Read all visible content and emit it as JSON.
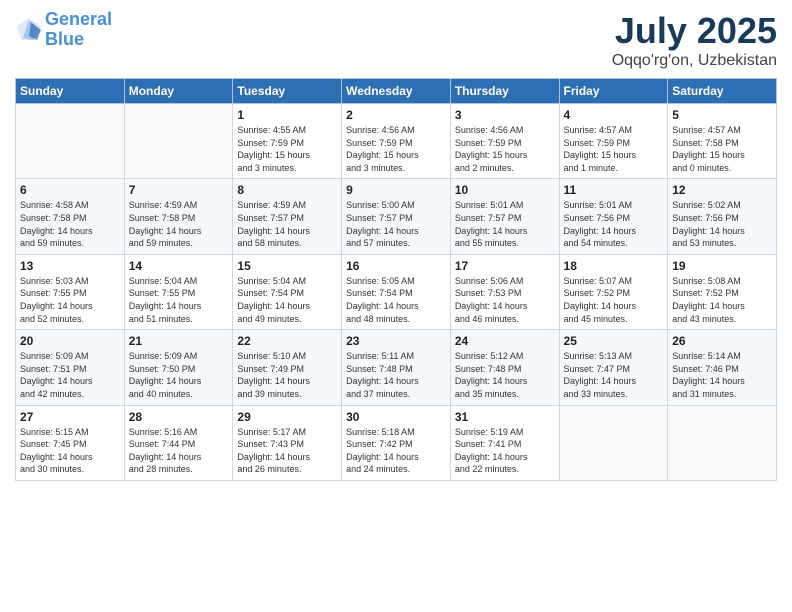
{
  "header": {
    "logo_line1": "General",
    "logo_line2": "Blue",
    "title": "July 2025",
    "subtitle": "Oqqo'rg'on, Uzbekistan"
  },
  "weekdays": [
    "Sunday",
    "Monday",
    "Tuesday",
    "Wednesday",
    "Thursday",
    "Friday",
    "Saturday"
  ],
  "weeks": [
    [
      {
        "day": "",
        "info": ""
      },
      {
        "day": "",
        "info": ""
      },
      {
        "day": "1",
        "info": "Sunrise: 4:55 AM\nSunset: 7:59 PM\nDaylight: 15 hours\nand 3 minutes."
      },
      {
        "day": "2",
        "info": "Sunrise: 4:56 AM\nSunset: 7:59 PM\nDaylight: 15 hours\nand 3 minutes."
      },
      {
        "day": "3",
        "info": "Sunrise: 4:56 AM\nSunset: 7:59 PM\nDaylight: 15 hours\nand 2 minutes."
      },
      {
        "day": "4",
        "info": "Sunrise: 4:57 AM\nSunset: 7:59 PM\nDaylight: 15 hours\nand 1 minute."
      },
      {
        "day": "5",
        "info": "Sunrise: 4:57 AM\nSunset: 7:58 PM\nDaylight: 15 hours\nand 0 minutes."
      }
    ],
    [
      {
        "day": "6",
        "info": "Sunrise: 4:58 AM\nSunset: 7:58 PM\nDaylight: 14 hours\nand 59 minutes."
      },
      {
        "day": "7",
        "info": "Sunrise: 4:59 AM\nSunset: 7:58 PM\nDaylight: 14 hours\nand 59 minutes."
      },
      {
        "day": "8",
        "info": "Sunrise: 4:59 AM\nSunset: 7:57 PM\nDaylight: 14 hours\nand 58 minutes."
      },
      {
        "day": "9",
        "info": "Sunrise: 5:00 AM\nSunset: 7:57 PM\nDaylight: 14 hours\nand 57 minutes."
      },
      {
        "day": "10",
        "info": "Sunrise: 5:01 AM\nSunset: 7:57 PM\nDaylight: 14 hours\nand 55 minutes."
      },
      {
        "day": "11",
        "info": "Sunrise: 5:01 AM\nSunset: 7:56 PM\nDaylight: 14 hours\nand 54 minutes."
      },
      {
        "day": "12",
        "info": "Sunrise: 5:02 AM\nSunset: 7:56 PM\nDaylight: 14 hours\nand 53 minutes."
      }
    ],
    [
      {
        "day": "13",
        "info": "Sunrise: 5:03 AM\nSunset: 7:55 PM\nDaylight: 14 hours\nand 52 minutes."
      },
      {
        "day": "14",
        "info": "Sunrise: 5:04 AM\nSunset: 7:55 PM\nDaylight: 14 hours\nand 51 minutes."
      },
      {
        "day": "15",
        "info": "Sunrise: 5:04 AM\nSunset: 7:54 PM\nDaylight: 14 hours\nand 49 minutes."
      },
      {
        "day": "16",
        "info": "Sunrise: 5:05 AM\nSunset: 7:54 PM\nDaylight: 14 hours\nand 48 minutes."
      },
      {
        "day": "17",
        "info": "Sunrise: 5:06 AM\nSunset: 7:53 PM\nDaylight: 14 hours\nand 46 minutes."
      },
      {
        "day": "18",
        "info": "Sunrise: 5:07 AM\nSunset: 7:52 PM\nDaylight: 14 hours\nand 45 minutes."
      },
      {
        "day": "19",
        "info": "Sunrise: 5:08 AM\nSunset: 7:52 PM\nDaylight: 14 hours\nand 43 minutes."
      }
    ],
    [
      {
        "day": "20",
        "info": "Sunrise: 5:09 AM\nSunset: 7:51 PM\nDaylight: 14 hours\nand 42 minutes."
      },
      {
        "day": "21",
        "info": "Sunrise: 5:09 AM\nSunset: 7:50 PM\nDaylight: 14 hours\nand 40 minutes."
      },
      {
        "day": "22",
        "info": "Sunrise: 5:10 AM\nSunset: 7:49 PM\nDaylight: 14 hours\nand 39 minutes."
      },
      {
        "day": "23",
        "info": "Sunrise: 5:11 AM\nSunset: 7:48 PM\nDaylight: 14 hours\nand 37 minutes."
      },
      {
        "day": "24",
        "info": "Sunrise: 5:12 AM\nSunset: 7:48 PM\nDaylight: 14 hours\nand 35 minutes."
      },
      {
        "day": "25",
        "info": "Sunrise: 5:13 AM\nSunset: 7:47 PM\nDaylight: 14 hours\nand 33 minutes."
      },
      {
        "day": "26",
        "info": "Sunrise: 5:14 AM\nSunset: 7:46 PM\nDaylight: 14 hours\nand 31 minutes."
      }
    ],
    [
      {
        "day": "27",
        "info": "Sunrise: 5:15 AM\nSunset: 7:45 PM\nDaylight: 14 hours\nand 30 minutes."
      },
      {
        "day": "28",
        "info": "Sunrise: 5:16 AM\nSunset: 7:44 PM\nDaylight: 14 hours\nand 28 minutes."
      },
      {
        "day": "29",
        "info": "Sunrise: 5:17 AM\nSunset: 7:43 PM\nDaylight: 14 hours\nand 26 minutes."
      },
      {
        "day": "30",
        "info": "Sunrise: 5:18 AM\nSunset: 7:42 PM\nDaylight: 14 hours\nand 24 minutes."
      },
      {
        "day": "31",
        "info": "Sunrise: 5:19 AM\nSunset: 7:41 PM\nDaylight: 14 hours\nand 22 minutes."
      },
      {
        "day": "",
        "info": ""
      },
      {
        "day": "",
        "info": ""
      }
    ]
  ]
}
